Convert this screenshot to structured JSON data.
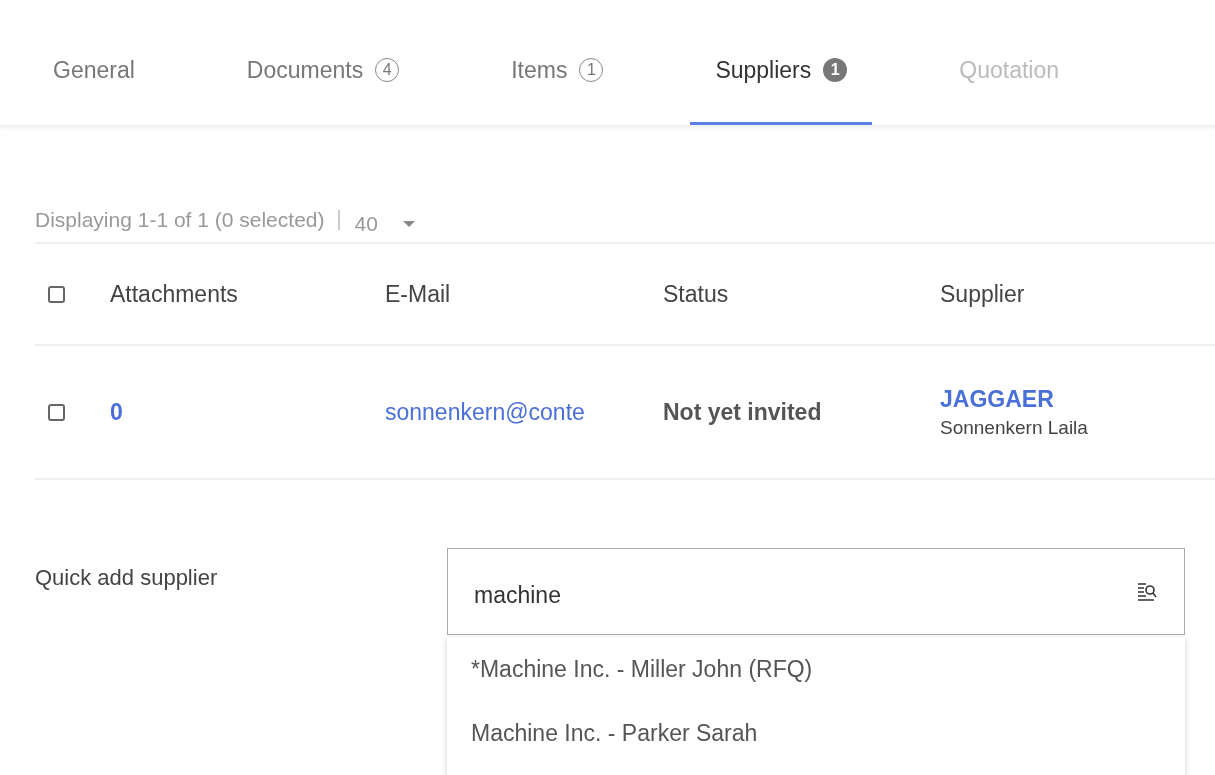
{
  "tabs": [
    {
      "label": "General",
      "selected": false,
      "disabled": false
    },
    {
      "label": "Documents",
      "badge": "4",
      "badge_filled": false,
      "selected": false,
      "disabled": false
    },
    {
      "label": "Items",
      "badge": "1",
      "badge_filled": false,
      "selected": false,
      "disabled": false
    },
    {
      "label": "Suppliers",
      "badge": "1",
      "badge_filled": true,
      "selected": true,
      "disabled": false
    },
    {
      "label": "Quotation",
      "selected": false,
      "disabled": true
    }
  ],
  "paging": {
    "summary": "Displaying 1-1 of 1 (0 selected)",
    "page_size": "40"
  },
  "table": {
    "select_all_checked": false,
    "columns": [
      "Attachments",
      "E-Mail",
      "Status",
      "Supplier"
    ],
    "rows": [
      {
        "checked": false,
        "attachments": "0",
        "email": "sonnenkern@conte",
        "status": "Not yet invited",
        "supplier": "JAGGAER",
        "contact": "Sonnenkern Laila"
      }
    ]
  },
  "quick_add": {
    "label": "Quick add supplier",
    "value": "machine",
    "suggestions": [
      "*Machine Inc. - Miller John (RFQ)",
      "Machine Inc. - Parker Sarah"
    ]
  }
}
